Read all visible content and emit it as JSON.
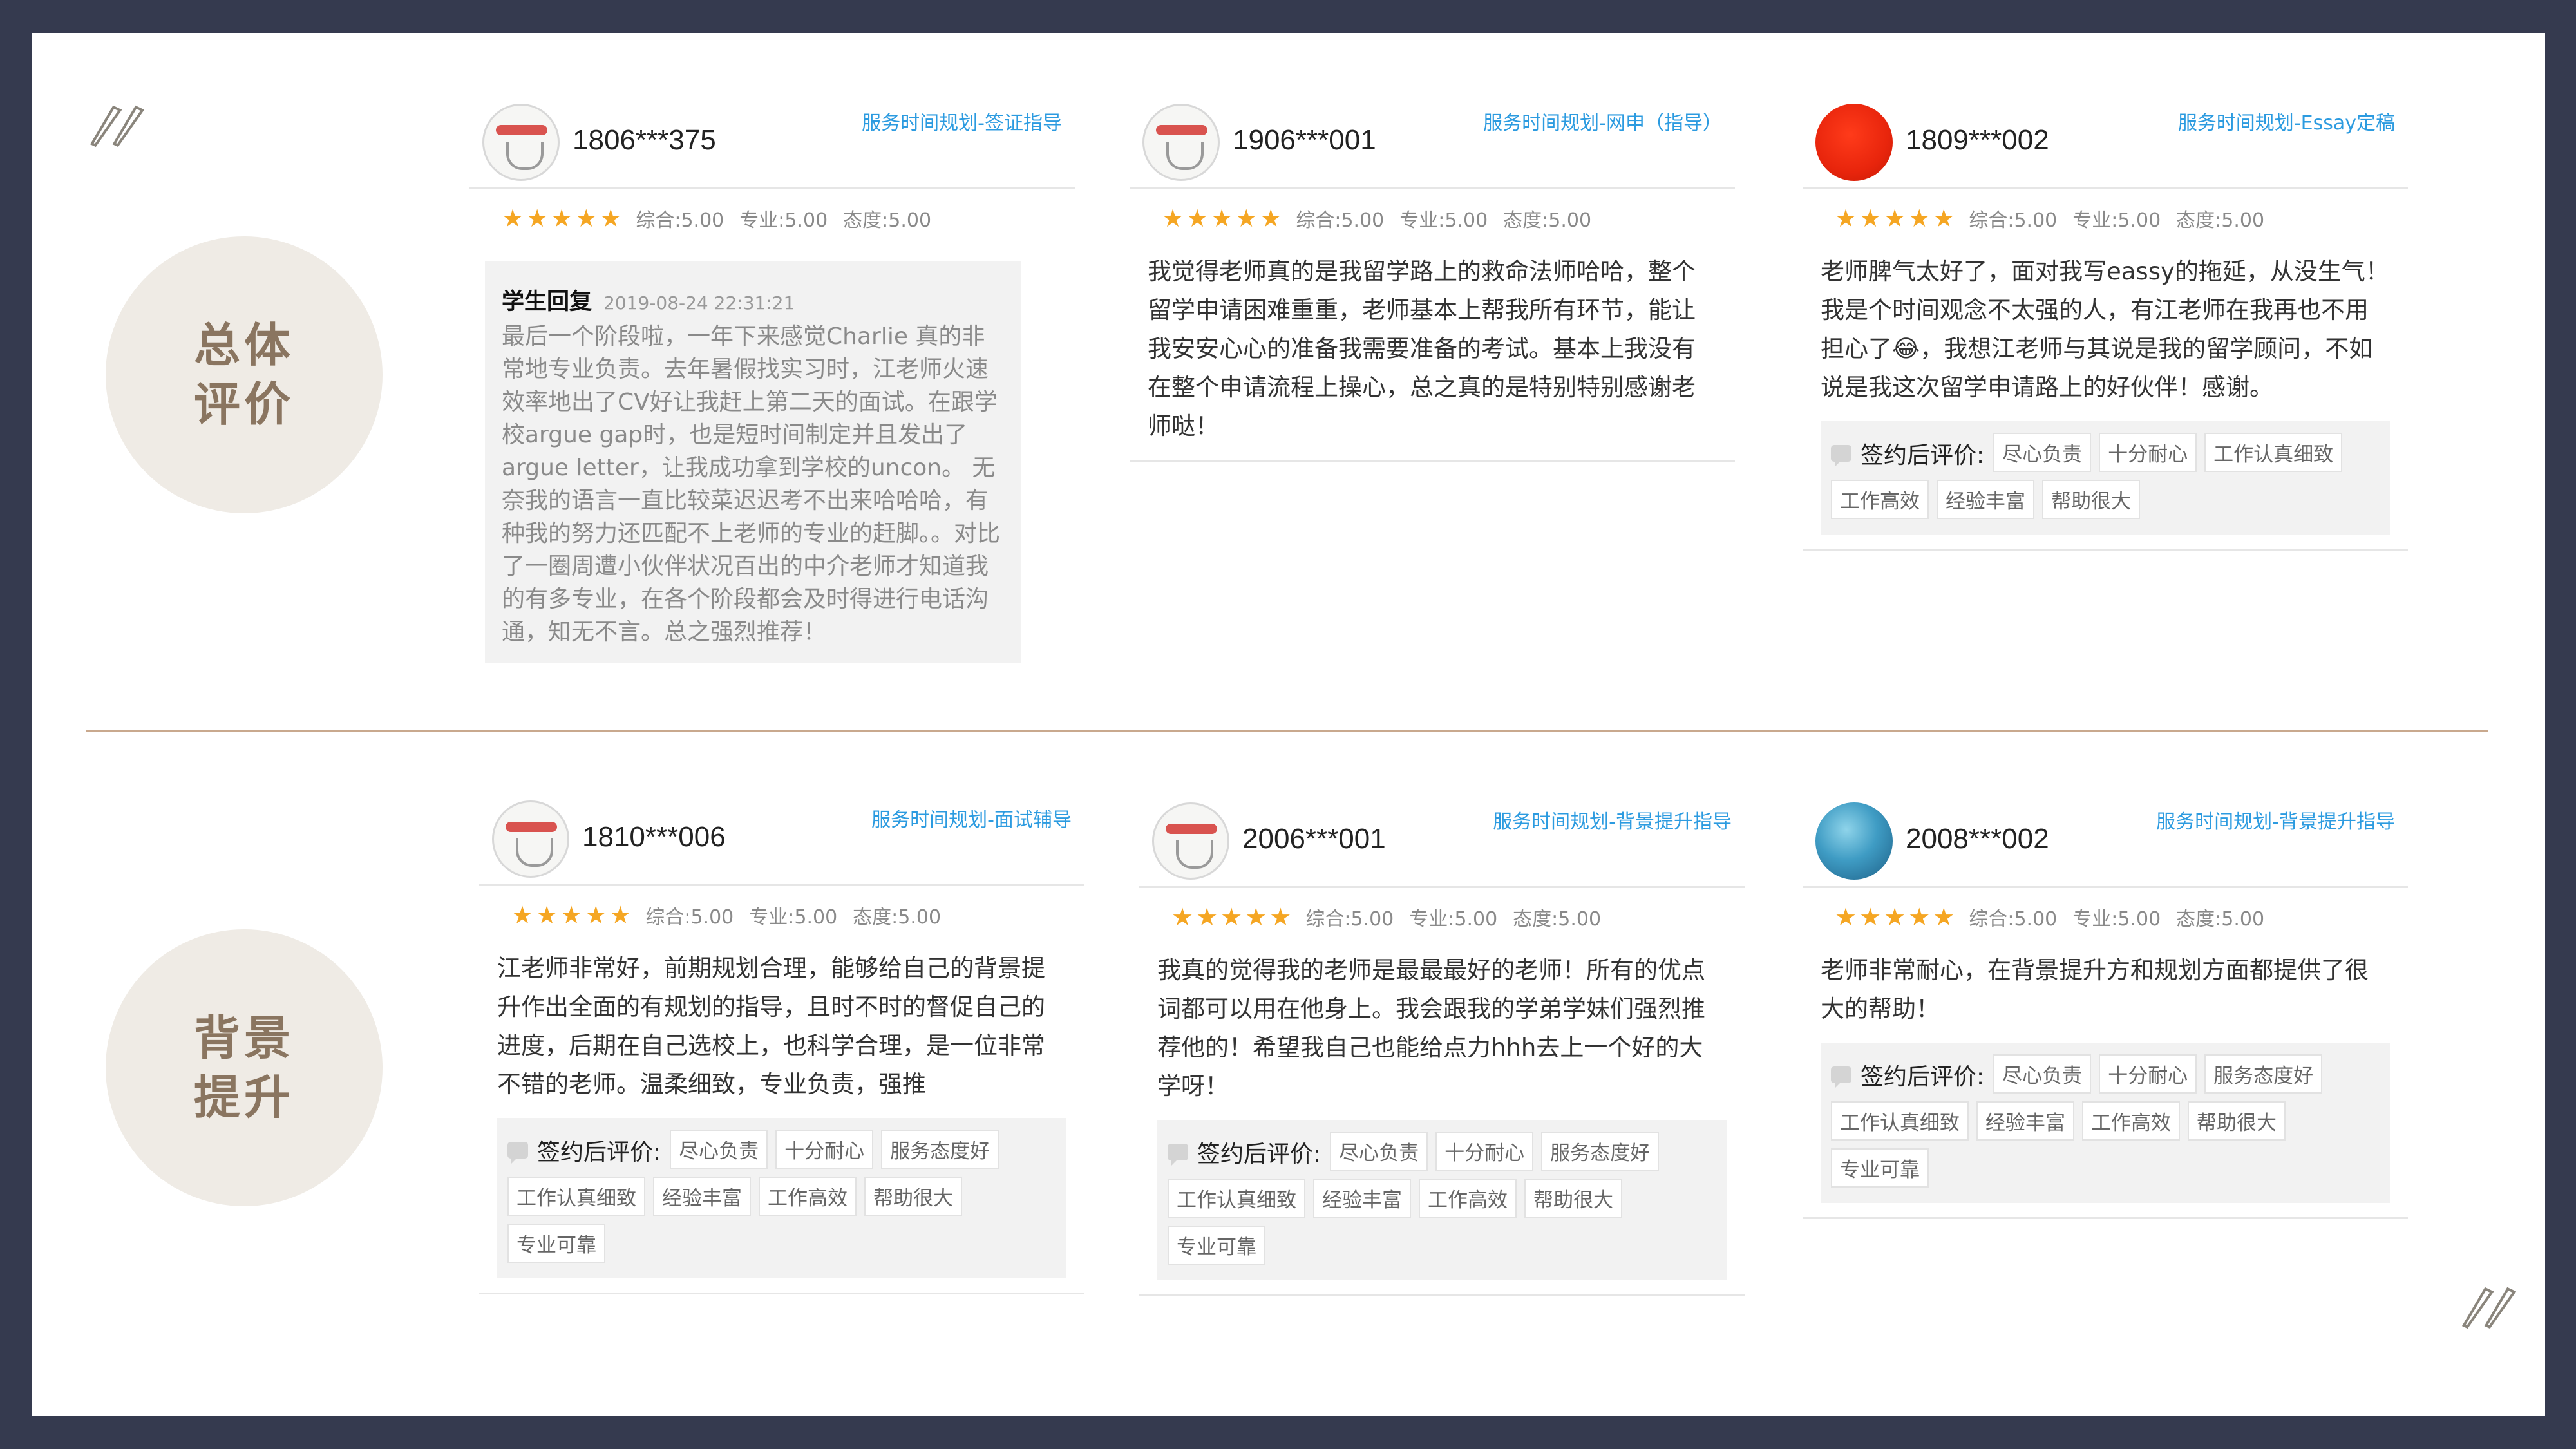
{
  "sections": [
    {
      "label": "总体\n评价"
    },
    {
      "label": "背景\n提升"
    }
  ],
  "cards": [
    {
      "user": "1806***375",
      "service": "服务时间规划-签证指导",
      "stars": "★★★★★",
      "scores": {
        "overall": "综合:5.00",
        "professional": "专业:5.00",
        "attitude": "态度:5.00"
      },
      "reply": {
        "title": "学生回复",
        "date": "2019-08-24 22:31:21",
        "text": "最后一个阶段啦，一年下来感觉Charlie 真的非常地专业负责。去年暑假找实习时，江老师火速效率地出了CV好让我赶上第二天的面试。在跟学校argue gap时，也是短时间制定并且发出了argue letter，让我成功拿到学校的uncon。 无奈我的语言一直比较菜迟迟考不出来哈哈哈，有种我的努力还匹配不上老师的专业的赶脚。。对比了一圈周遭小伙伴状况百出的中介老师才知道我的有多专业，在各个阶段都会及时得进行电话沟通，知无不言。总之强烈推荐！"
      }
    },
    {
      "user": "1906***001",
      "service": "服务时间规划-网申（指导）",
      "stars": "★★★★★",
      "scores": {
        "overall": "综合:5.00",
        "professional": "专业:5.00",
        "attitude": "态度:5.00"
      },
      "review": "我觉得老师真的是我留学路上的救命法师哈哈，整个留学申请困难重重，老师基本上帮我所有环节，能让我安安心心的准备我需要准备的考试。基本上我没有在整个申请流程上操心，总之真的是特别特别感谢老师哒！"
    },
    {
      "user": "1809***002",
      "service": "服务时间规划-Essay定稿",
      "stars": "★★★★★",
      "scores": {
        "overall": "综合:5.00",
        "professional": "专业:5.00",
        "attitude": "态度:5.00"
      },
      "review": "老师脾气太好了，面对我写eassy的拖延，从没生气！我是个时间观念不太强的人，有江老师在我再也不用担心了😂，我想江老师与其说是我的留学顾问，不如说是我这次留学申请路上的好伙伴！感谢。",
      "tag_title": "签约后评价:",
      "tags": [
        "尽心负责",
        "十分耐心",
        "工作认真细致",
        "工作高效",
        "经验丰富",
        "帮助很大"
      ]
    },
    {
      "user": "1810***006",
      "service": "服务时间规划-面试辅导",
      "stars": "★★★★★",
      "scores": {
        "overall": "综合:5.00",
        "professional": "专业:5.00",
        "attitude": "态度:5.00"
      },
      "review": "江老师非常好，前期规划合理，能够给自己的背景提升作出全面的有规划的指导，且时不时的督促自己的进度，后期在自己选校上，也科学合理，是一位非常不错的老师。温柔细致，专业负责，强推",
      "tag_title": "签约后评价:",
      "tags": [
        "尽心负责",
        "十分耐心",
        "服务态度好",
        "工作认真细致",
        "经验丰富",
        "工作高效",
        "帮助很大",
        "专业可靠"
      ]
    },
    {
      "user": "2006***001",
      "service": "服务时间规划-背景提升指导",
      "stars": "★★★★★",
      "scores": {
        "overall": "综合:5.00",
        "professional": "专业:5.00",
        "attitude": "态度:5.00"
      },
      "review": "我真的觉得我的老师是最最最好的老师！所有的优点词都可以用在他身上。我会跟我的学弟学妹们强烈推荐他的！希望我自己也能给点力hhh去上一个好的大学呀！",
      "tag_title": "签约后评价:",
      "tags": [
        "尽心负责",
        "十分耐心",
        "服务态度好",
        "工作认真细致",
        "经验丰富",
        "工作高效",
        "帮助很大",
        "专业可靠"
      ]
    },
    {
      "user": "2008***002",
      "service": "服务时间规划-背景提升指导",
      "stars": "★★★★★",
      "scores": {
        "overall": "综合:5.00",
        "professional": "专业:5.00",
        "attitude": "态度:5.00"
      },
      "review": "老师非常耐心，在背景提升方和规划方面都提供了很大的帮助！",
      "tag_title": "签约后评价:",
      "tags": [
        "尽心负责",
        "十分耐心",
        "服务态度好",
        "工作认真细致",
        "经验丰富",
        "工作高效",
        "帮助很大",
        "专业可靠"
      ]
    }
  ]
}
